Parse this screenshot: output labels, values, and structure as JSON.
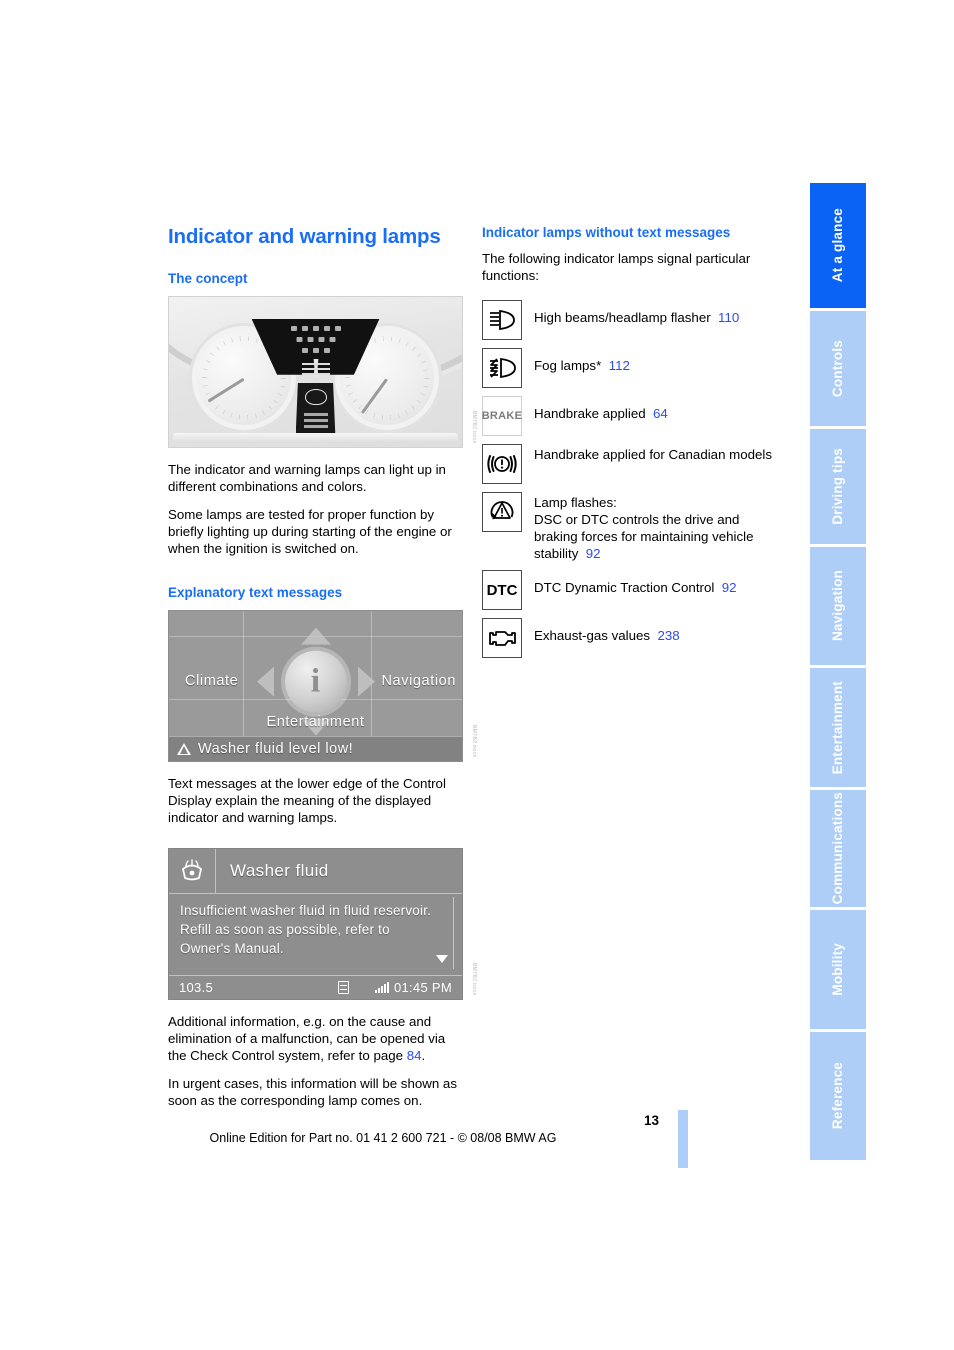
{
  "document": {
    "page_number": "13",
    "edition_line": "Online Edition for Part no. 01 41 2 600 721 - © 08/08 BMW AG"
  },
  "sidebar": {
    "tabs": [
      {
        "label": "At a glance",
        "active": true
      },
      {
        "label": "Controls",
        "active": false
      },
      {
        "label": "Driving tips",
        "active": false
      },
      {
        "label": "Navigation",
        "active": false
      },
      {
        "label": "Entertainment",
        "active": false
      },
      {
        "label": "Communications",
        "active": false
      },
      {
        "label": "Mobility",
        "active": false
      },
      {
        "label": "Reference",
        "active": false
      }
    ],
    "active_color": "#0a63f5",
    "inactive_color": "#aecdf7"
  },
  "left_column": {
    "title": "Indicator and warning lamps",
    "section_concept": {
      "heading": "The concept",
      "figure_caption_code": "BM7B2.book",
      "paragraphs": [
        "The indicator and warning lamps can light up in different combinations and colors.",
        "Some lamps are tested for proper function by briefly lighting up during starting of the engine or when the ignition is switched on."
      ]
    },
    "section_text_messages": {
      "heading": "Explanatory text messages",
      "paragraph_1": "Text messages at the lower edge of the Control Display explain the meaning of the displayed indicator and warning lamps.",
      "paragraph_2_pre": "Additional information, e.g. on the cause and elimination of a malfunction, can be opened via the Check Control system, refer to page ",
      "paragraph_2_ref": "84",
      "paragraph_2_post": ".",
      "paragraph_3": "In urgent cases, this information will be shown as soon as the corresponding lamp comes on."
    }
  },
  "idrive_figure": {
    "menu_items": {
      "climate": "Climate",
      "navigation": "Navigation",
      "entertainment": "Entertainment"
    },
    "center_icon": "i",
    "status_message": "Washer fluid level low!"
  },
  "checkcontrol_figure": {
    "title": "Washer fluid",
    "body": "Insufficient washer fluid in fluid reservoir.\nRefill as soon as possible, refer to Owner's Manual.",
    "radio_frequency": "103.5",
    "clock": "01:45 PM"
  },
  "right_column": {
    "heading": "Indicator lamps without text messages",
    "intro": "The following indicator lamps signal particular functions:",
    "lamps": [
      {
        "icon": "high-beam-icon",
        "text": "High beams/headlamp flasher",
        "page_ref": "110",
        "asterisk": ""
      },
      {
        "icon": "fog-lamp-icon",
        "text": "Fog lamps",
        "page_ref": "112",
        "asterisk": "*"
      },
      {
        "icon": "brake-text-icon",
        "text": "Handbrake applied",
        "page_ref": "64",
        "asterisk": ""
      },
      {
        "icon": "brake-warning-icon",
        "text": "Handbrake applied for Canadian models",
        "page_ref": "",
        "asterisk": ""
      },
      {
        "icon": "dsc-warning-icon",
        "text": "Lamp flashes:\nDSC or DTC controls the drive and braking forces for maintaining vehicle stability",
        "page_ref": "92",
        "asterisk": ""
      },
      {
        "icon": "dtc-text-icon",
        "text": "DTC Dynamic Traction Control",
        "page_ref": "92",
        "asterisk": ""
      },
      {
        "icon": "check-engine-icon",
        "text": "Exhaust-gas values",
        "page_ref": "238",
        "asterisk": ""
      }
    ]
  },
  "colors": {
    "heading_blue": "#1a6ef5",
    "reference_blue": "#2d4bf0",
    "tab_active": "#0a63f5",
    "tab_inactive": "#aecdf7"
  }
}
